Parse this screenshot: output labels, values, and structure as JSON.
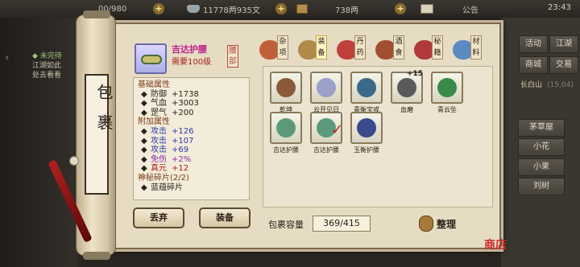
{
  "topbar": {
    "currency1": "00/980",
    "currency2": "11778两935文",
    "currency3": "738两",
    "announcement": "公告",
    "time": "23:43"
  },
  "quest": {
    "title": "◆ 未完待",
    "line1": "江湖如此",
    "line2": "处去看看"
  },
  "scroll_title": "包裹",
  "item": {
    "name": "吉达护腰",
    "requirement": "需要100级",
    "slot": "腰部"
  },
  "attributes": {
    "base_header": "基础属性",
    "base": [
      {
        "label": "防御",
        "value": "+1738"
      },
      {
        "label": "气血",
        "value": "+3003"
      },
      {
        "label": "罡气",
        "value": "+200"
      }
    ],
    "extra_header": "附加属性",
    "extra": [
      {
        "label": "攻击",
        "value": "+126",
        "tone": "blue"
      },
      {
        "label": "攻击",
        "value": "+107",
        "tone": "blue"
      },
      {
        "label": "攻击",
        "value": "+69",
        "tone": "blue"
      },
      {
        "label": "免伤",
        "value": "+2%",
        "tone": "purple"
      },
      {
        "label": "真元",
        "value": "+12",
        "tone": "red"
      }
    ],
    "fragment_header": "神秘碎片(2/2)",
    "fragment": "蓝蕴碎片"
  },
  "buttons": {
    "discard": "丢弃",
    "equip": "装备",
    "sort": "整理"
  },
  "categories": [
    {
      "label": "杂项",
      "color": "#c0603a"
    },
    {
      "label": "装备",
      "color": "#b08a4a"
    },
    {
      "label": "丹药",
      "color": "#c0403a"
    },
    {
      "label": "酒食",
      "color": "#a05030"
    },
    {
      "label": "秘籍",
      "color": "#b03a3a"
    },
    {
      "label": "材料",
      "color": "#5a8ac0"
    }
  ],
  "items": [
    {
      "name": "乾坤",
      "color": "#8a5a3a"
    },
    {
      "name": "云开见日",
      "color": "#9aa0c8"
    },
    {
      "name": "青衡宝戒",
      "color": "#3a6a8a"
    },
    {
      "name": "血磨",
      "color": "#5a5a5a",
      "badge": "+15"
    },
    {
      "name": "青云坠",
      "color": "#3a8a4a"
    },
    {
      "name": "吉达护腰",
      "color": "#5a9a7a"
    },
    {
      "name": "吉达护腰",
      "color": "#5a9a7a"
    },
    {
      "name": "玉衡护腰",
      "color": "#3a4a8a"
    }
  ],
  "capacity": {
    "label": "包裹容量",
    "value": "369/415"
  },
  "right_panel": {
    "huodong": "活动",
    "jianghu": "江湖",
    "shangcheng": "商城",
    "jiaoyi": "交易",
    "location": "长白山",
    "coords": "(15,04)",
    "places": [
      "茅草屋",
      "小花",
      "小果",
      "刘树"
    ]
  },
  "stamp": "商店"
}
